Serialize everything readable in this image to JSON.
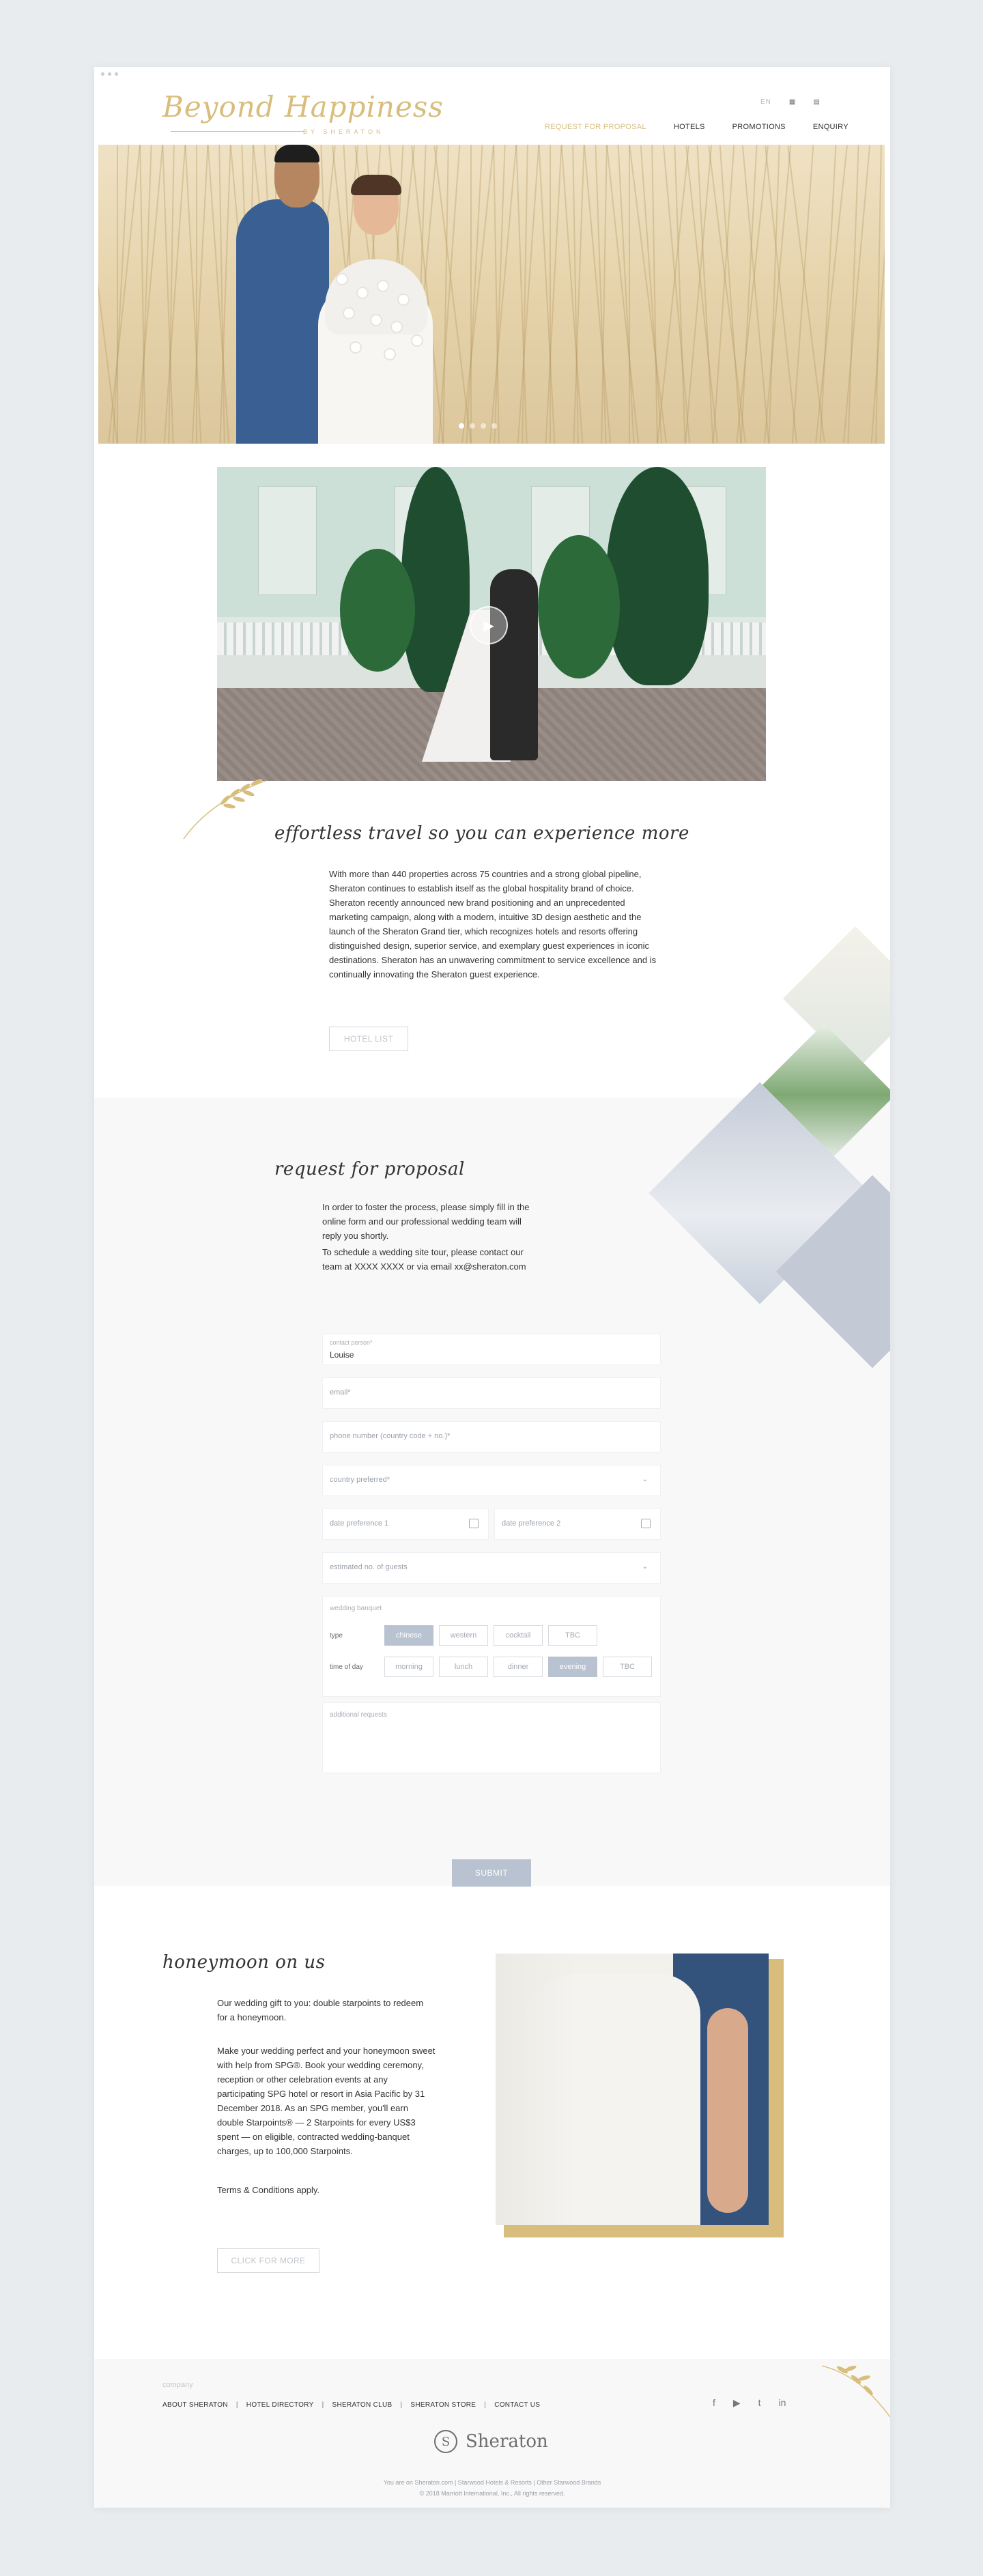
{
  "header": {
    "logo_script": "Beyond Happiness",
    "logo_sub": "BY SHERATON",
    "utility": {
      "lang": "EN",
      "icon1": "▦",
      "icon2": "▤"
    },
    "nav": [
      {
        "label": "REQUEST FOR PROPOSAL",
        "active": true
      },
      {
        "label": "HOTELS"
      },
      {
        "label": "PROMOTIONS"
      },
      {
        "label": "ENQUIRY"
      }
    ]
  },
  "intro": {
    "heading": "effortless travel so you can experience more",
    "body": "With more than 440 properties across 75 countries and a strong global pipeline, Sheraton continues to establish itself as the global hospitality brand of choice. Sheraton recently announced new brand positioning and an unprecedented marketing campaign, along with a modern, intuitive 3D design aesthetic and the launch of the Sheraton Grand tier, which recognizes hotels and resorts offering distinguished design, superior service, and exemplary guest experiences in iconic destinations. Sheraton has an unwavering commitment to service excellence and is continually innovating the Sheraton guest experience.",
    "button": "HOTEL LIST"
  },
  "proposal": {
    "heading": "request for proposal",
    "p1": "In order to foster the process, please simply fill in the online form and our professional wedding team will reply you shortly.",
    "p2": "To schedule a wedding site tour, please contact our team at XXXX XXXX or via email xx@sheraton.com",
    "contact_label": "contact person*",
    "contact_value": "Louise",
    "email_ph": "email*",
    "phone_ph": "phone number (country code + no.)*",
    "country_ph": "country preferred*",
    "date1_ph": "date preference 1",
    "date2_ph": "date preference 2",
    "guests_ph": "estimated no. of guests",
    "banquet_label": "wedding banquet",
    "type_label": "type",
    "type_options": [
      "chinese",
      "western",
      "cocktail",
      "TBC"
    ],
    "type_selected": 0,
    "time_label": "time of day",
    "time_options": [
      "morning",
      "lunch",
      "dinner",
      "evening",
      "TBC"
    ],
    "time_selected": 3,
    "requests_ph": "additional requests",
    "submit": "SUBMIT"
  },
  "honeymoon": {
    "heading": "honeymoon on us",
    "p1": "Our wedding gift to you: double starpoints to redeem for a honeymoon.",
    "p2": "Make your wedding perfect and your honeymoon sweet with help from SPG®. Book your wedding ceremony, reception or other celebration events at any participating SPG hotel or resort in Asia Pacific by 31 December 2018. As an SPG member, you'll earn double Starpoints® — 2 Starpoints for every US$3 spent — on eligible, contracted wedding-banquet charges, up to 100,000 Starpoints.",
    "p3": "Terms & Conditions apply.",
    "button": "CLICK FOR MORE"
  },
  "video_icon": "play-icon",
  "footer": {
    "company": "company",
    "links": [
      "ABOUT SHERATON",
      "HOTEL DIRECTORY",
      "SHERATON CLUB",
      "SHERATON STORE",
      "CONTACT US"
    ],
    "social": [
      "f",
      "▶",
      "t",
      "in"
    ],
    "brand_letter": "S",
    "brand_word": "Sheraton",
    "legal1": "You are on Sheraton.com | Starwood Hotels & Resorts | Other Starwood Brands",
    "legal2": "© 2018 Marriott International, Inc., All rights reserved."
  },
  "colors": {
    "gold": "#d8bd7c",
    "accent": "#b9c2d0",
    "section_bg": "#f8f8f8"
  }
}
